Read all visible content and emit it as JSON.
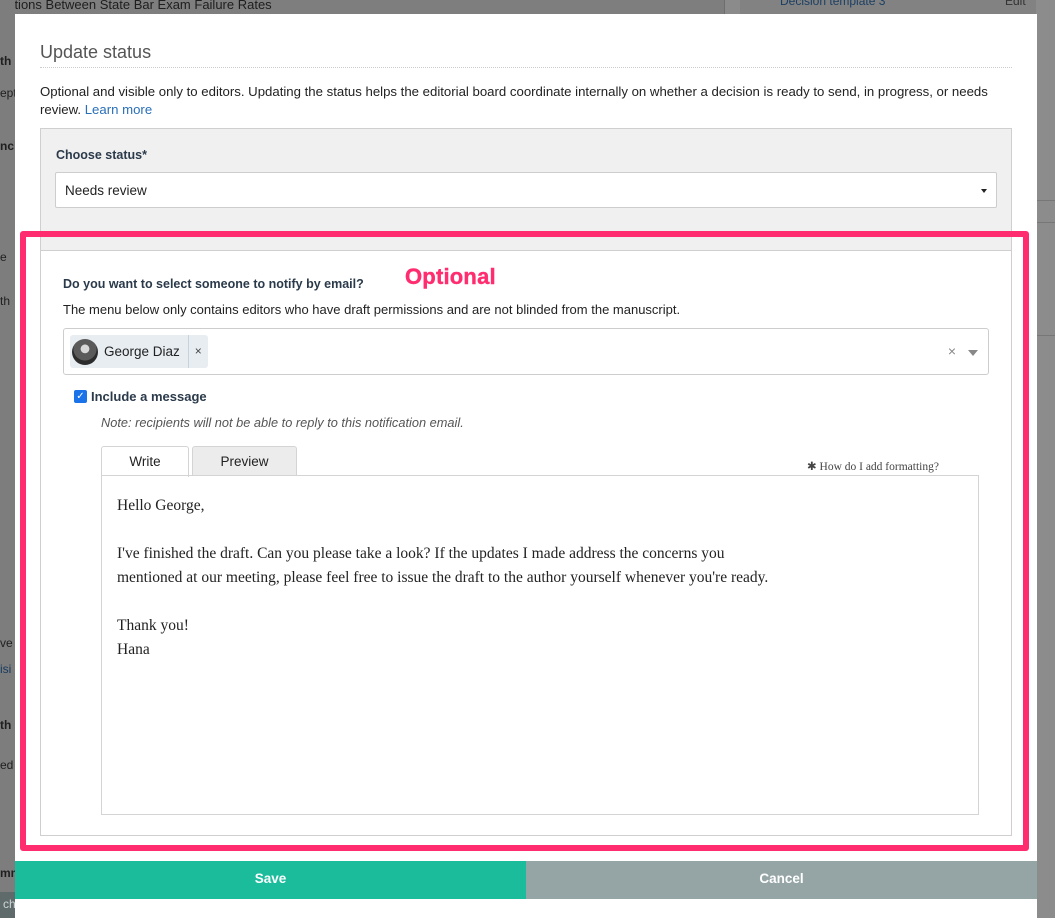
{
  "background": {
    "page_title": "riations Between State Bar Exam Failure Rates",
    "right_link": "Decision template 3",
    "right_edit": "Edit",
    "left_fragments": [
      "th",
      "ept",
      "nc",
      "e",
      "th",
      "ve",
      "isi",
      "th",
      "ed",
      "mm"
    ],
    "attach_button": "ch File"
  },
  "modal": {
    "title": "Update status",
    "intro_text": "Optional and visible only to editors. Updating the status helps the editorial board coordinate internally on whether a decision is ready to send, in progress, or needs review.",
    "learn_more": "Learn more"
  },
  "status": {
    "label": "Choose status*",
    "selected": "Needs review"
  },
  "notify": {
    "question": "Do you want to select someone to notify by email?",
    "annotation": "Optional",
    "description": "The menu below only contains editors who have draft permissions and are not blinded from the manuscript.",
    "recipients": [
      {
        "name": "George Diaz",
        "remove": "×"
      }
    ],
    "clear": "×",
    "include_message_label": "Include a message",
    "include_message_checked": true,
    "note": "Note: recipients will not be able to reply to this notification email.",
    "tabs": {
      "write": "Write",
      "preview": "Preview"
    },
    "formatting_help": "✱ How do I add formatting?",
    "message_lines": {
      "greeting": "Hello George,",
      "body_1": "I've finished the draft. Can you please take a look? If the updates I made address the concerns you",
      "body_2": "mentioned at our meeting, please feel free to issue the draft to the author yourself whenever you're ready.",
      "closing": "Thank you!",
      "signature": "Hana"
    }
  },
  "actions": {
    "save": "Save",
    "cancel": "Cancel"
  },
  "colors": {
    "highlight": "#ff2d6f",
    "save": "#1abc9c",
    "cancel": "#95a5a6",
    "link": "#2a6fb8"
  }
}
